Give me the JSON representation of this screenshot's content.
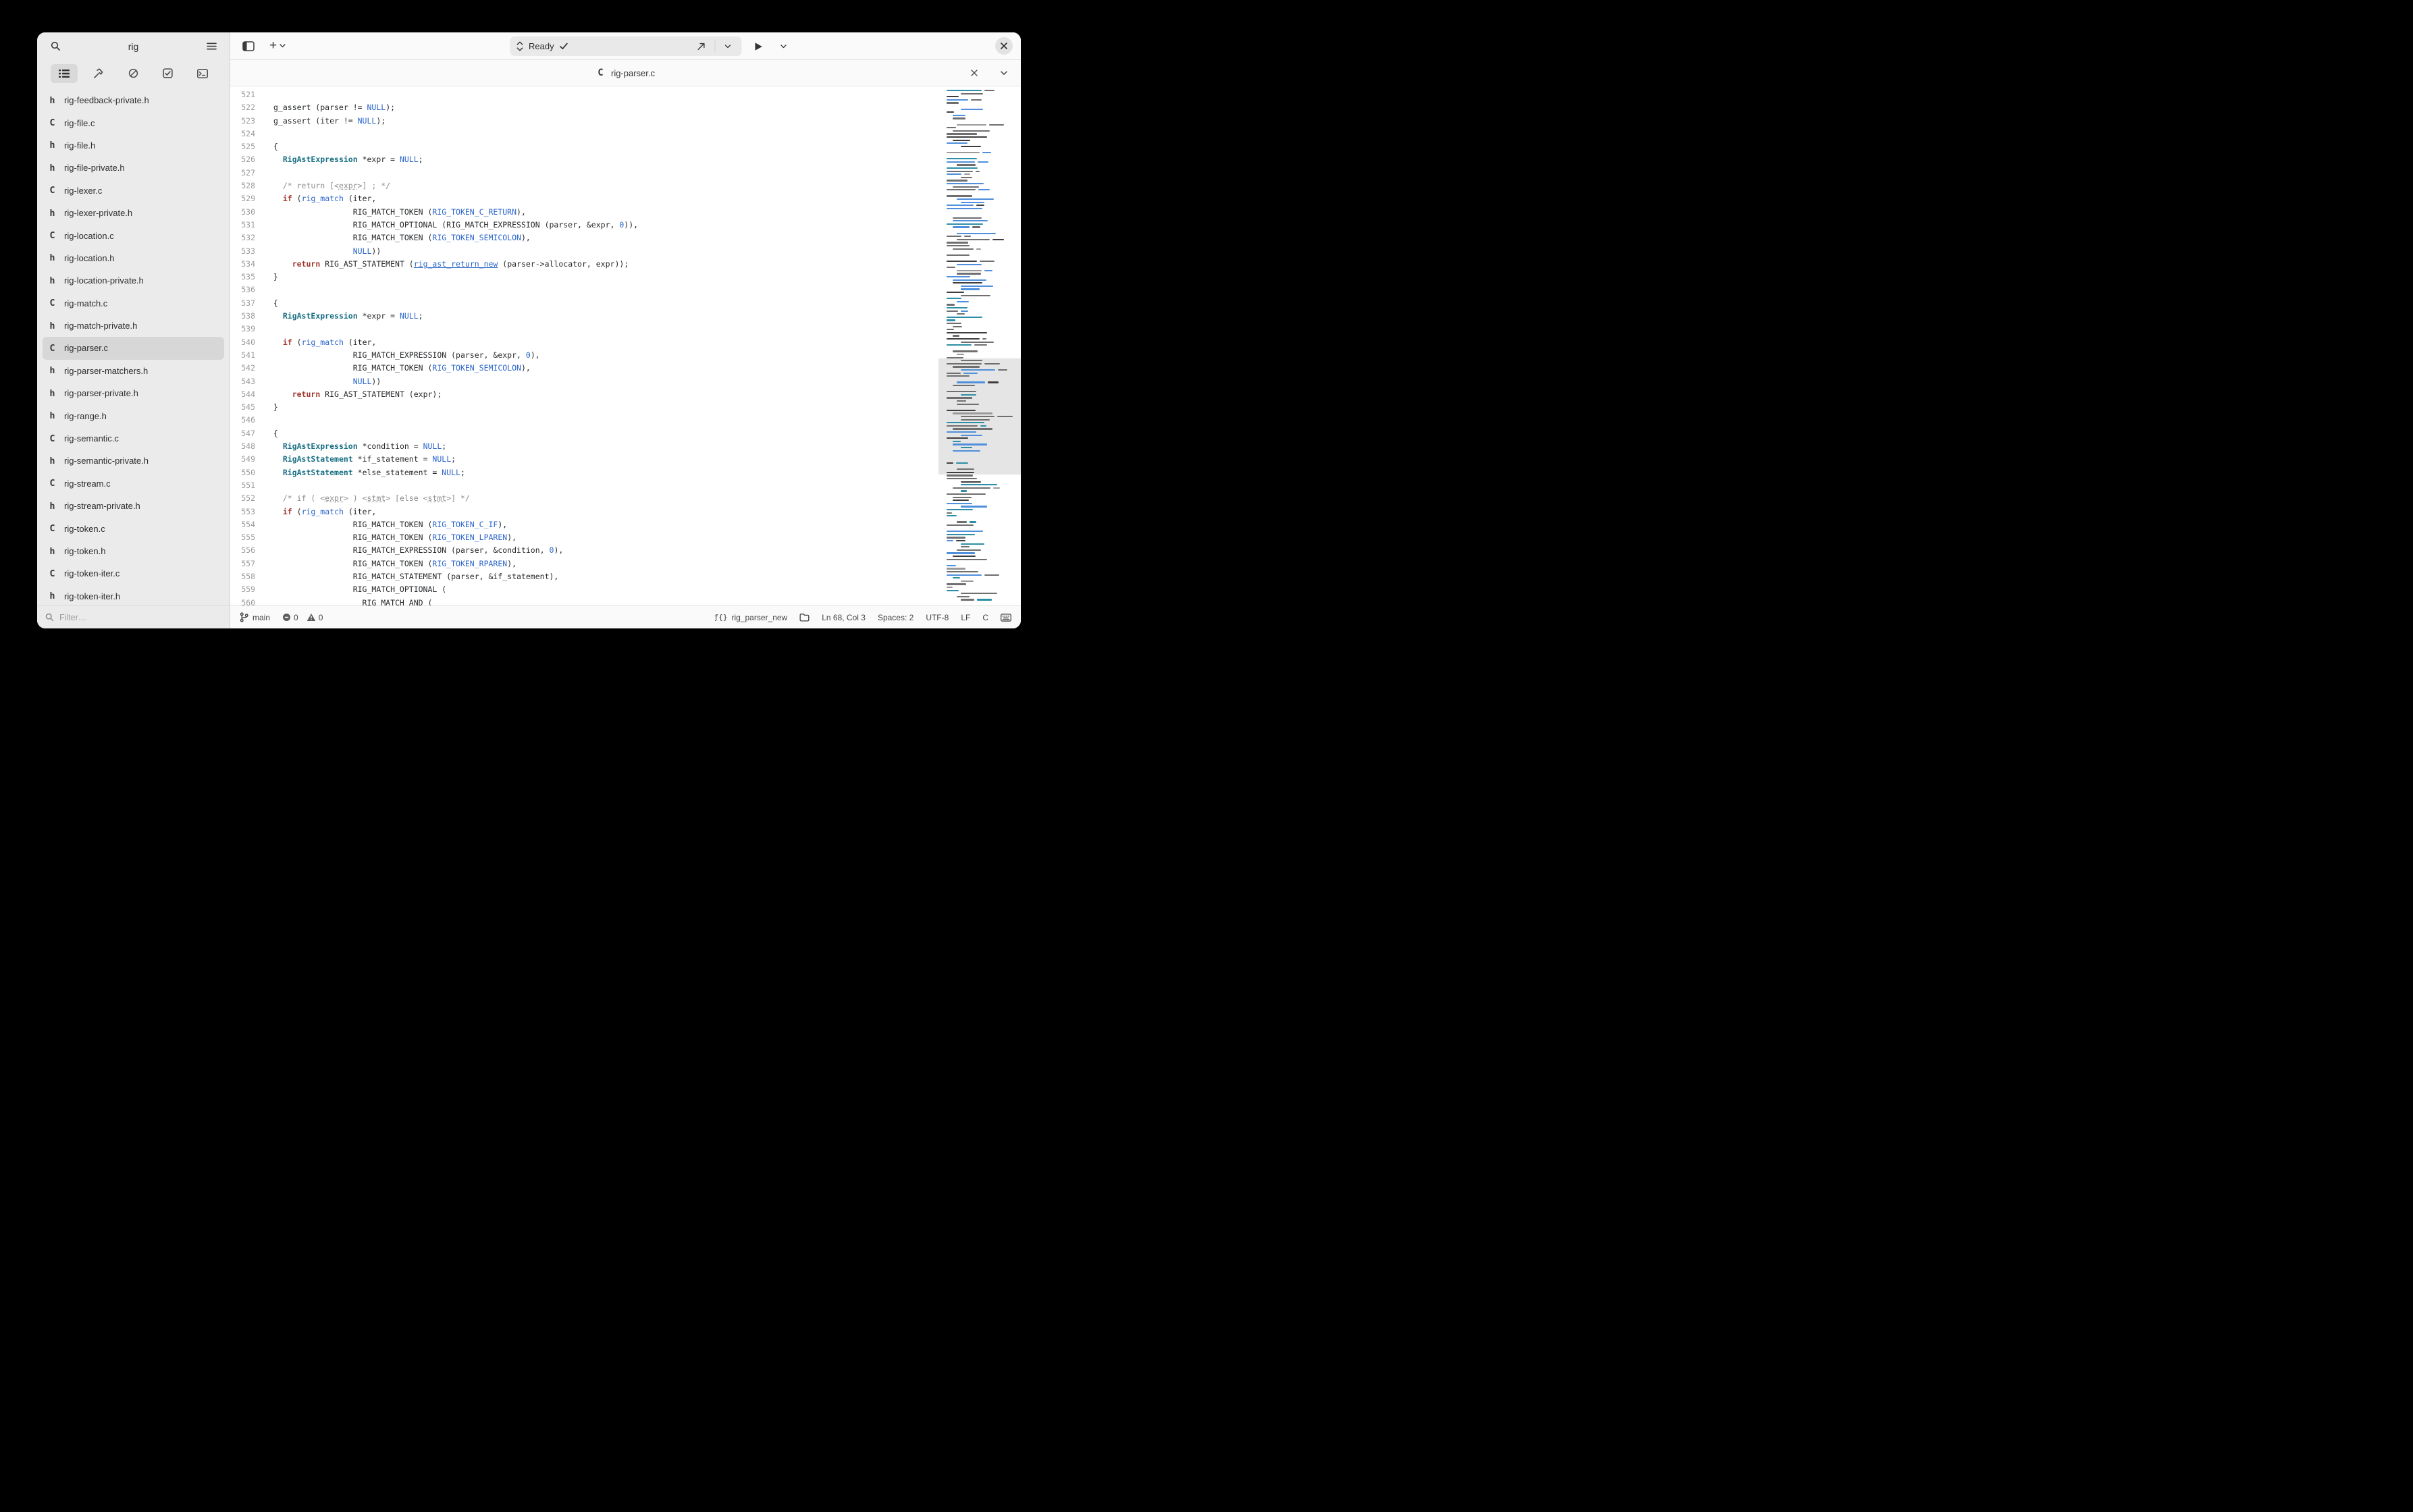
{
  "window": {
    "title": "rig"
  },
  "colors": {
    "keyword": "#a0372e",
    "type": "#156e82",
    "identifier": "#2a65cc",
    "comment": "#8a8c8e",
    "accent_blue": "#3584e4",
    "sidebar_bg": "#ebebeb",
    "selection_pill": "#d7d7d7",
    "headerbar_bg": "#fafafa"
  },
  "icons": [
    "search-icon",
    "hamburger-menu-icon",
    "todo-list-icon",
    "build-hammer-icon",
    "circle-slash-icon",
    "tests-checkbox-icon",
    "terminal-icon",
    "panel-toggle-icon",
    "add-icon",
    "chevron-down-icon",
    "up-down-chevrons-icon",
    "check-icon",
    "deploy-arrow-icon",
    "play-icon",
    "close-icon",
    "git-branch-icon",
    "error-circle-icon",
    "warning-triangle-icon",
    "function-icon",
    "folder-icon",
    "keyboard-icon",
    "c-file-icon",
    "h-file-icon"
  ],
  "sidebar": {
    "title": "rig",
    "panel_tabs": [
      {
        "icon": "todo-list",
        "selected": true
      },
      {
        "icon": "build-hammer",
        "selected": false
      },
      {
        "icon": "circle-slash",
        "selected": false
      },
      {
        "icon": "tests-checkbox",
        "selected": false
      },
      {
        "icon": "terminal",
        "selected": false
      }
    ],
    "files": [
      {
        "kind": "h",
        "name": "rig-feedback-private.h",
        "selected": false
      },
      {
        "kind": "C",
        "name": "rig-file.c",
        "selected": false
      },
      {
        "kind": "h",
        "name": "rig-file.h",
        "selected": false
      },
      {
        "kind": "h",
        "name": "rig-file-private.h",
        "selected": false
      },
      {
        "kind": "C",
        "name": "rig-lexer.c",
        "selected": false
      },
      {
        "kind": "h",
        "name": "rig-lexer-private.h",
        "selected": false
      },
      {
        "kind": "C",
        "name": "rig-location.c",
        "selected": false
      },
      {
        "kind": "h",
        "name": "rig-location.h",
        "selected": false
      },
      {
        "kind": "h",
        "name": "rig-location-private.h",
        "selected": false
      },
      {
        "kind": "C",
        "name": "rig-match.c",
        "selected": false
      },
      {
        "kind": "h",
        "name": "rig-match-private.h",
        "selected": false
      },
      {
        "kind": "C",
        "name": "rig-parser.c",
        "selected": true
      },
      {
        "kind": "h",
        "name": "rig-parser-matchers.h",
        "selected": false
      },
      {
        "kind": "h",
        "name": "rig-parser-private.h",
        "selected": false
      },
      {
        "kind": "h",
        "name": "rig-range.h",
        "selected": false
      },
      {
        "kind": "C",
        "name": "rig-semantic.c",
        "selected": false
      },
      {
        "kind": "h",
        "name": "rig-semantic-private.h",
        "selected": false
      },
      {
        "kind": "C",
        "name": "rig-stream.c",
        "selected": false
      },
      {
        "kind": "h",
        "name": "rig-stream-private.h",
        "selected": false
      },
      {
        "kind": "C",
        "name": "rig-token.c",
        "selected": false
      },
      {
        "kind": "h",
        "name": "rig-token.h",
        "selected": false
      },
      {
        "kind": "C",
        "name": "rig-token-iter.c",
        "selected": false
      },
      {
        "kind": "h",
        "name": "rig-token-iter.h",
        "selected": false
      }
    ],
    "filter_placeholder": "Filter…"
  },
  "header": {
    "add_glyph": "+",
    "omnibar": {
      "label": "Ready"
    }
  },
  "tab": {
    "kind": "C",
    "title": "rig-parser.c"
  },
  "editor": {
    "lines": [
      {
        "no": 521,
        "seg": []
      },
      {
        "no": 522,
        "seg": [
          [
            "g_assert (parser != ",
            "p"
          ],
          [
            "NULL",
            "b"
          ],
          [
            ");",
            "p"
          ]
        ]
      },
      {
        "no": 523,
        "seg": [
          [
            "g_assert (iter != ",
            "p"
          ],
          [
            "NULL",
            "b"
          ],
          [
            ");",
            "p"
          ]
        ]
      },
      {
        "no": 524,
        "seg": []
      },
      {
        "no": 525,
        "seg": [
          [
            "{",
            "p"
          ]
        ]
      },
      {
        "no": 526,
        "seg": [
          [
            "  ",
            "p"
          ],
          [
            "RigAstExpression",
            "t"
          ],
          [
            " *expr = ",
            "p"
          ],
          [
            "NULL",
            "b"
          ],
          [
            ";",
            "p"
          ]
        ]
      },
      {
        "no": 527,
        "seg": []
      },
      {
        "no": 528,
        "seg": [
          [
            "  /* return [<",
            "c"
          ],
          [
            "expr",
            "cu"
          ],
          [
            ">] ; */",
            "c"
          ]
        ]
      },
      {
        "no": 529,
        "seg": [
          [
            "  ",
            "p"
          ],
          [
            "if",
            "k"
          ],
          [
            " (",
            "p"
          ],
          [
            "rig_match",
            "b"
          ],
          [
            " (iter,",
            "p"
          ]
        ]
      },
      {
        "no": 530,
        "seg": [
          [
            "                 RIG_MATCH_TOKEN (",
            "p"
          ],
          [
            "RIG_TOKEN_C_RETURN",
            "b"
          ],
          [
            "),",
            "p"
          ]
        ]
      },
      {
        "no": 531,
        "seg": [
          [
            "                 RIG_MATCH_OPTIONAL (RIG_MATCH_EXPRESSION (parser, &expr, ",
            "p"
          ],
          [
            "0",
            "b"
          ],
          [
            ")),",
            "p"
          ]
        ]
      },
      {
        "no": 532,
        "seg": [
          [
            "                 RIG_MATCH_TOKEN (",
            "p"
          ],
          [
            "RIG_TOKEN_SEMICOLON",
            "b"
          ],
          [
            "),",
            "p"
          ]
        ]
      },
      {
        "no": 533,
        "seg": [
          [
            "                 ",
            "p"
          ],
          [
            "NULL",
            "b"
          ],
          [
            "))",
            "p"
          ]
        ]
      },
      {
        "no": 534,
        "seg": [
          [
            "    ",
            "p"
          ],
          [
            "return",
            "k"
          ],
          [
            " RIG_AST_STATEMENT (",
            "p"
          ],
          [
            "rig_ast_return_new",
            "bu"
          ],
          [
            " (parser->allocator, expr));",
            "p"
          ]
        ]
      },
      {
        "no": 535,
        "seg": [
          [
            "}",
            "p"
          ]
        ]
      },
      {
        "no": 536,
        "seg": []
      },
      {
        "no": 537,
        "seg": [
          [
            "{",
            "p"
          ]
        ]
      },
      {
        "no": 538,
        "seg": [
          [
            "  ",
            "p"
          ],
          [
            "RigAstExpression",
            "t"
          ],
          [
            " *expr = ",
            "p"
          ],
          [
            "NULL",
            "b"
          ],
          [
            ";",
            "p"
          ]
        ]
      },
      {
        "no": 539,
        "seg": []
      },
      {
        "no": 540,
        "seg": [
          [
            "  ",
            "p"
          ],
          [
            "if",
            "k"
          ],
          [
            " (",
            "p"
          ],
          [
            "rig_match",
            "b"
          ],
          [
            " (iter,",
            "p"
          ]
        ]
      },
      {
        "no": 541,
        "seg": [
          [
            "                 RIG_MATCH_EXPRESSION (parser, &expr, ",
            "p"
          ],
          [
            "0",
            "b"
          ],
          [
            "),",
            "p"
          ]
        ]
      },
      {
        "no": 542,
        "seg": [
          [
            "                 RIG_MATCH_TOKEN (",
            "p"
          ],
          [
            "RIG_TOKEN_SEMICOLON",
            "b"
          ],
          [
            "),",
            "p"
          ]
        ]
      },
      {
        "no": 543,
        "seg": [
          [
            "                 ",
            "p"
          ],
          [
            "NULL",
            "b"
          ],
          [
            "))",
            "p"
          ]
        ]
      },
      {
        "no": 544,
        "seg": [
          [
            "    ",
            "p"
          ],
          [
            "return",
            "k"
          ],
          [
            " RIG_AST_STATEMENT (expr);",
            "p"
          ]
        ]
      },
      {
        "no": 545,
        "seg": [
          [
            "}",
            "p"
          ]
        ]
      },
      {
        "no": 546,
        "seg": []
      },
      {
        "no": 547,
        "seg": [
          [
            "{",
            "p"
          ]
        ]
      },
      {
        "no": 548,
        "seg": [
          [
            "  ",
            "p"
          ],
          [
            "RigAstExpression",
            "t"
          ],
          [
            " *condition = ",
            "p"
          ],
          [
            "NULL",
            "b"
          ],
          [
            ";",
            "p"
          ]
        ]
      },
      {
        "no": 549,
        "seg": [
          [
            "  ",
            "p"
          ],
          [
            "RigAstStatement",
            "t"
          ],
          [
            " *if_statement = ",
            "p"
          ],
          [
            "NULL",
            "b"
          ],
          [
            ";",
            "p"
          ]
        ]
      },
      {
        "no": 550,
        "seg": [
          [
            "  ",
            "p"
          ],
          [
            "RigAstStatement",
            "t"
          ],
          [
            " *else_statement = ",
            "p"
          ],
          [
            "NULL",
            "b"
          ],
          [
            ";",
            "p"
          ]
        ]
      },
      {
        "no": 551,
        "seg": []
      },
      {
        "no": 552,
        "seg": [
          [
            "  /* if ( <",
            "c"
          ],
          [
            "expr",
            "cu"
          ],
          [
            "> ) <",
            "c"
          ],
          [
            "stmt",
            "cu"
          ],
          [
            "> [else <",
            "c"
          ],
          [
            "stmt",
            "cu"
          ],
          [
            ">] */",
            "c"
          ]
        ]
      },
      {
        "no": 553,
        "seg": [
          [
            "  ",
            "p"
          ],
          [
            "if",
            "k"
          ],
          [
            " (",
            "p"
          ],
          [
            "rig_match",
            "b"
          ],
          [
            " (iter,",
            "p"
          ]
        ]
      },
      {
        "no": 554,
        "seg": [
          [
            "                 RIG_MATCH_TOKEN (",
            "p"
          ],
          [
            "RIG_TOKEN_C_IF",
            "b"
          ],
          [
            "),",
            "p"
          ]
        ]
      },
      {
        "no": 555,
        "seg": [
          [
            "                 RIG_MATCH_TOKEN (",
            "p"
          ],
          [
            "RIG_TOKEN_LPAREN",
            "b"
          ],
          [
            "),",
            "p"
          ]
        ]
      },
      {
        "no": 556,
        "seg": [
          [
            "                 RIG_MATCH_EXPRESSION (parser, &condition, ",
            "p"
          ],
          [
            "0",
            "b"
          ],
          [
            "),",
            "p"
          ]
        ]
      },
      {
        "no": 557,
        "seg": [
          [
            "                 RIG_MATCH_TOKEN (",
            "p"
          ],
          [
            "RIG_TOKEN_RPAREN",
            "b"
          ],
          [
            "),",
            "p"
          ]
        ]
      },
      {
        "no": 558,
        "seg": [
          [
            "                 RIG_MATCH_STATEMENT (parser, &if_statement),",
            "p"
          ]
        ]
      },
      {
        "no": 559,
        "seg": [
          [
            "                 RIG_MATCH_OPTIONAL (",
            "p"
          ]
        ]
      },
      {
        "no": 560,
        "seg": [
          [
            "                   RIG_MATCH_AND (",
            "p"
          ]
        ]
      }
    ]
  },
  "statusbar": {
    "branch": "main",
    "errors": "0",
    "warnings": "0",
    "function_icon": "ƒ{}",
    "symbol": "rig_parser_new",
    "position": "Ln 68, Col 3",
    "spaces": "Spaces: 2",
    "encoding": "UTF-8",
    "eol": "LF",
    "language": "C"
  }
}
